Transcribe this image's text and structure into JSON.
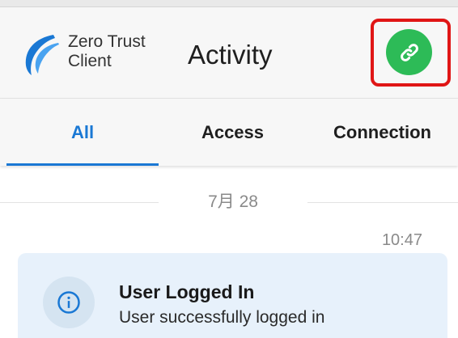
{
  "app": {
    "brand_line1": "Zero Trust",
    "brand_line2": "Client",
    "page_title": "Activity",
    "connect_icon": "link-icon",
    "connect_color": "#2dbb57",
    "highlight_color": "#e01616"
  },
  "tabs": [
    {
      "label": "All",
      "active": true
    },
    {
      "label": "Access",
      "active": false
    },
    {
      "label": "Connection",
      "active": false
    }
  ],
  "accent_color": "#1a78d4",
  "activity": {
    "date": "7月 28",
    "time": "10:47",
    "items": [
      {
        "icon": "info-icon",
        "title": "User Logged In",
        "description": "User successfully logged in"
      }
    ]
  }
}
